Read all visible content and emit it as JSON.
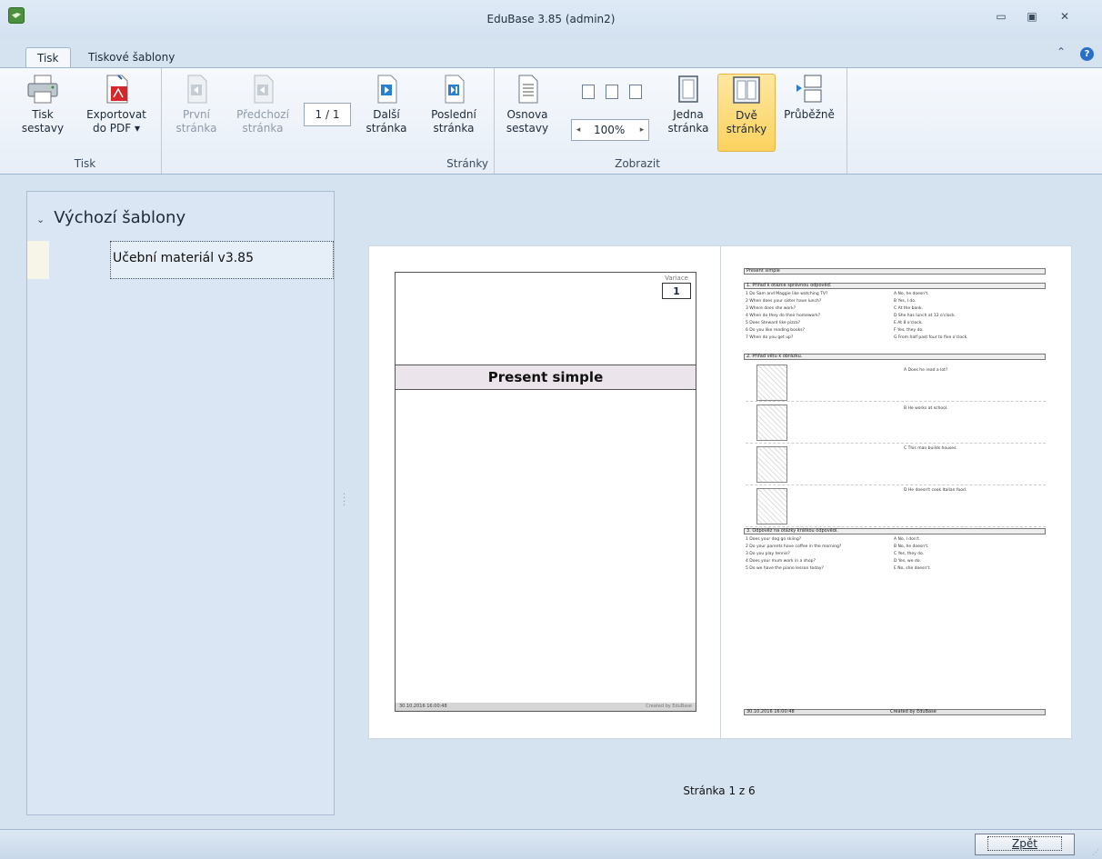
{
  "window": {
    "title": "EduBase 3.85 (admin2)"
  },
  "tabs": [
    {
      "label": "Tisk",
      "active": true
    },
    {
      "label": "Tiskové šablony",
      "active": false
    }
  ],
  "ribbon": {
    "groups": {
      "print": "Tisk",
      "pages": "Stránky",
      "view": "Zobrazit"
    },
    "buttons": {
      "print_report": [
        "Tisk",
        "sestavy"
      ],
      "export_pdf": [
        "Exportovat",
        "do PDF ▾"
      ],
      "first_page": [
        "První",
        "stránka"
      ],
      "prev_page": [
        "Předchozí",
        "stránka"
      ],
      "next_page": [
        "Další",
        "stránka"
      ],
      "last_page": [
        "Poslední",
        "stránka"
      ],
      "outline": [
        "Osnova",
        "sestavy"
      ],
      "one_page": [
        "Jedna",
        "stránka"
      ],
      "two_pages": [
        "Dvě",
        "stránky"
      ],
      "continuous": [
        "Průběžně",
        ""
      ]
    },
    "page_indicator": "1 / 1",
    "zoom": "100%"
  },
  "tree": {
    "header": "Výchozí šablony",
    "items": [
      "Učební materiál v3.85"
    ]
  },
  "preview": {
    "page1": {
      "variant_label": "Variace",
      "variant_value": "1",
      "title": "Present simple",
      "footer_left": "30.10.2016 16:00:48",
      "footer_right": "Created by EduBase"
    },
    "page2": {
      "header": "Present simple",
      "section1": "1.   Přiřaď k otázce správnou odpověď.",
      "section2": "2.   Přiřaď větu k obrázku.",
      "section3": "3.   Odpověz na otázky krátkou odpovědí.",
      "questions1": [
        "1  Do Sam and Maggie like watching TV?",
        "2  When does your sister have lunch?",
        "3  Where does she work?",
        "4  When do they do their homework?",
        "5  Does Steward like pizza?",
        "6  Do you like reading books?",
        "7  When do you get up?"
      ],
      "answers1": [
        "A  No, he doesn't.",
        "B  Yes, I do.",
        "C  At the bank.",
        "D  She has lunch at 12 o'clock.",
        "E  At 8 o'clock.",
        "F  Yes, they do.",
        "G  From half past four to five o'clock."
      ],
      "sentences2": [
        "A  Does he read a lot?",
        "B  He works at school.",
        "C  This man builds houses.",
        "D  He doesn't cook Italian food."
      ],
      "questions3": [
        "1  Does your dog go skiing?",
        "2  Do your parents have coffee in the morning?",
        "3  Do you play tennis?",
        "4  Does your mum work in a shop?",
        "5  Do we have the piano lesson today?"
      ],
      "answers3": [
        "A  No, I don't.",
        "B  No, he doesn't.",
        "C  Yes, they do.",
        "D  Yes, we do.",
        "E  No, she doesn't."
      ],
      "footer_left": "30.10.2016 16:00:48",
      "footer_right": "Created by EduBase"
    }
  },
  "status": {
    "page_info": "Stránka 1 z 6"
  },
  "footer": {
    "back_button": "Zpět"
  }
}
